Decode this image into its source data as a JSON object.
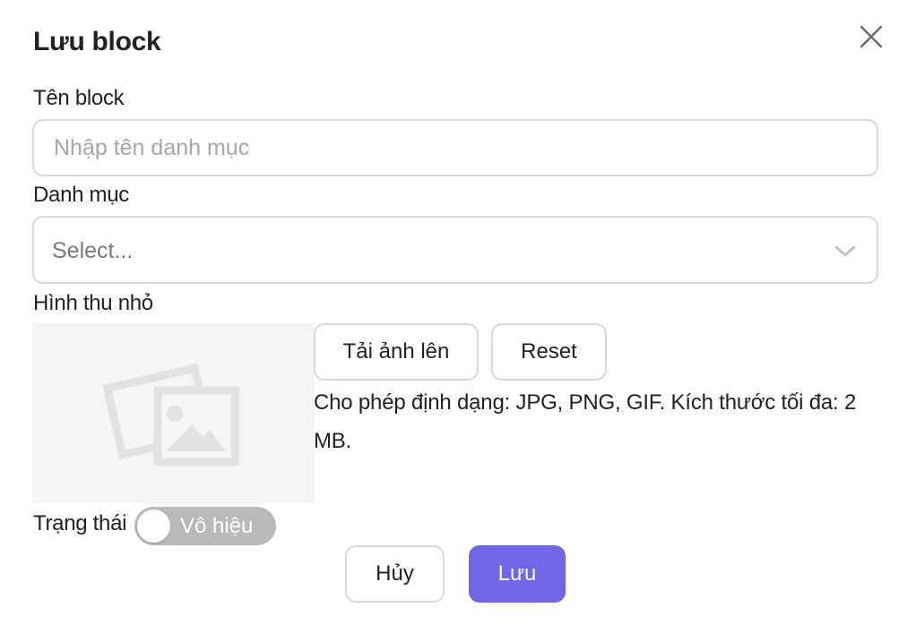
{
  "modal": {
    "title": "Lưu block"
  },
  "form": {
    "name_label": "Tên block",
    "name_placeholder": "Nhập tên danh mục",
    "name_value": "",
    "category_label": "Danh mục",
    "category_selected": "Select...",
    "thumbnail_label": "Hình thu nhỏ",
    "upload_label": "Tải ảnh lên",
    "reset_label": "Reset",
    "upload_hint": "Cho phép định dạng: JPG, PNG, GIF. Kích thước tối đa: 2 MB.",
    "status_label": "Trạng thái",
    "status_toggle_text": "Vô hiệu",
    "status_enabled": false
  },
  "footer": {
    "cancel_label": "Hủy",
    "save_label": "Lưu"
  },
  "icons": {
    "close": "close-icon",
    "dropdown": "chevron-down-icon",
    "thumbnail_placeholder": "image-placeholder-icon"
  },
  "colors": {
    "primary": "#7066e6",
    "toggle_off": "#b9b9b9",
    "border": "#d9d9d9",
    "placeholder_bg": "#f5f5f5"
  }
}
